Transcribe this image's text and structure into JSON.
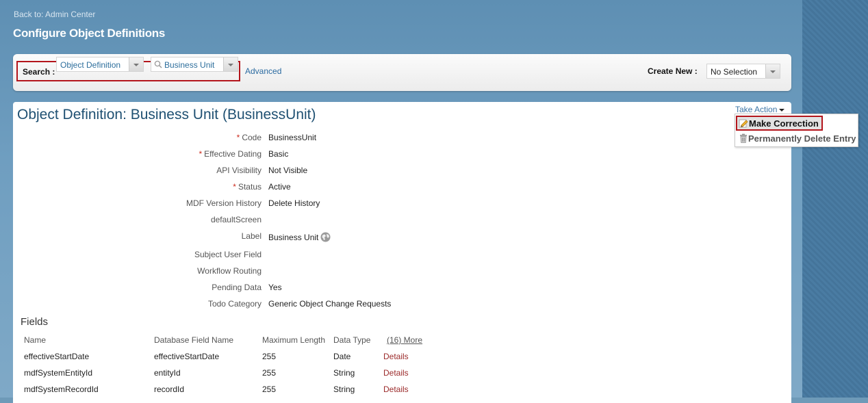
{
  "header": {
    "back_link": "Back to: Admin Center",
    "title": "Configure Object Definitions"
  },
  "search": {
    "label": "Search :",
    "object_type": "Object Definition",
    "object_value": "Business Unit",
    "advanced": "Advanced",
    "create_new_label": "Create New :",
    "create_new_value": "No Selection"
  },
  "object": {
    "title": "Object Definition: Business Unit (BusinessUnit)",
    "take_action": "Take Action",
    "fields": [
      {
        "label": "Code",
        "required": "*",
        "value": "BusinessUnit"
      },
      {
        "label": "Effective Dating",
        "required": "*",
        "value": "Basic"
      },
      {
        "label": "API Visibility",
        "required": "",
        "value": "Not Visible"
      },
      {
        "label": "Status",
        "required": "*",
        "value": "Active"
      },
      {
        "label": "MDF Version History",
        "required": "",
        "value": "Delete History"
      },
      {
        "label": "defaultScreen",
        "required": "",
        "value": ""
      },
      {
        "label": "Label",
        "required": "",
        "value": "Business Unit"
      },
      {
        "label": "Subject User Field",
        "required": "",
        "value": ""
      },
      {
        "label": "Workflow Routing",
        "required": "",
        "value": ""
      },
      {
        "label": "Pending Data",
        "required": "",
        "value": "Yes"
      },
      {
        "label": "Todo Category",
        "required": "",
        "value": "Generic Object Change Requests"
      }
    ]
  },
  "menu": {
    "make_correction": "Make Correction",
    "delete_entry": "Permanently Delete Entry"
  },
  "fields_table": {
    "heading": "Fields",
    "headers": [
      "Name",
      "Database Field Name",
      "Maximum Length",
      "Data Type"
    ],
    "more": "(16) More",
    "rows": [
      {
        "name": "effectiveStartDate",
        "db": "effectiveStartDate",
        "max": "255",
        "type": "Date",
        "action": "Details"
      },
      {
        "name": "mdfSystemEntityId",
        "db": "entityId",
        "max": "255",
        "type": "String",
        "action": "Details"
      },
      {
        "name": "mdfSystemRecordId",
        "db": "recordId",
        "max": "255",
        "type": "String",
        "action": "Details"
      }
    ]
  },
  "colors": {
    "highlight_border": "#b3141b",
    "title_blue": "#1f5072",
    "details_link": "#9b2a2a",
    "required_star": "#cc2b1d"
  },
  "icons": [
    "search-icon",
    "chevron-down-icon",
    "pencil-edit-icon",
    "trash-icon",
    "globe-icon",
    "caret-down-icon"
  ]
}
